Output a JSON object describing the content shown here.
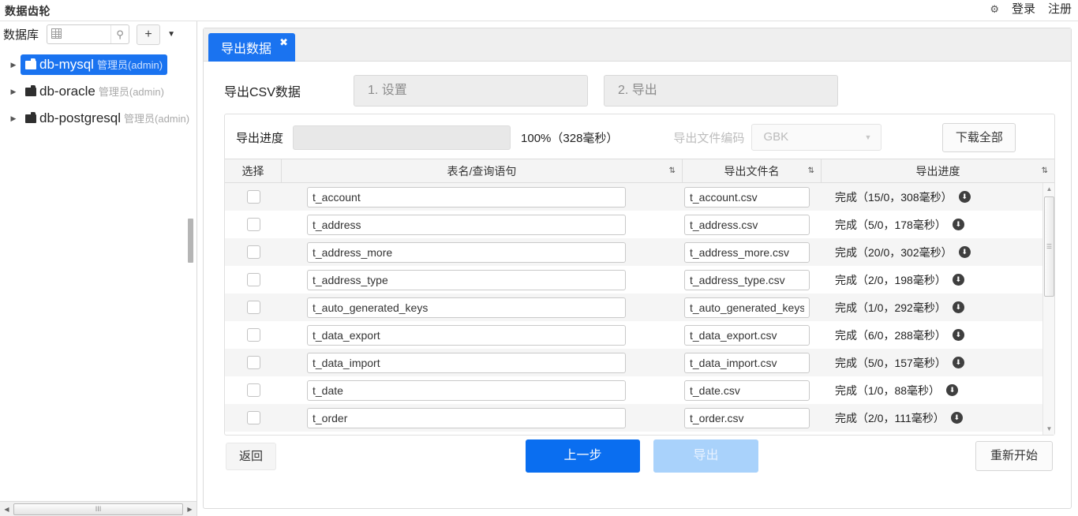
{
  "topbar": {
    "app_title": "数据齿轮",
    "gear_icon": "gear-icon",
    "login_label": "登录",
    "register_label": "注册"
  },
  "sidebar": {
    "db_label": "数据库",
    "search_value": "",
    "search_placeholder": "",
    "grid_icon": "grid-icon",
    "search_icon": "search-icon",
    "add_label": "+",
    "caret_label": "▼",
    "items": [
      {
        "name": "db-mysql",
        "role": "管理员(admin)",
        "selected": true
      },
      {
        "name": "db-oracle",
        "role": "管理员(admin)",
        "selected": false
      },
      {
        "name": "db-postgresql",
        "role": "管理员(admin)",
        "selected": false
      }
    ],
    "hscroll_grip": "III"
  },
  "tabs": [
    {
      "label": "导出数据",
      "close": "✖",
      "active": true
    }
  ],
  "wizard": {
    "title": "导出CSV数据",
    "steps": [
      {
        "label": "1. 设置"
      },
      {
        "label": "2. 导出"
      }
    ]
  },
  "progress": {
    "label": "导出进度",
    "percent_text": "100%（328毫秒）",
    "bar_percent": 0,
    "encoding_label": "导出文件编码",
    "encoding_value": "GBK",
    "encoding_caret": "▼",
    "download_all_label": "下载全部"
  },
  "table": {
    "headers": [
      {
        "label": "选择",
        "sortable": false
      },
      {
        "label": "表名/查询语句",
        "sortable": true
      },
      {
        "label": "导出文件名",
        "sortable": true
      },
      {
        "label": "导出进度",
        "sortable": true
      }
    ],
    "sort_icon": "⇅",
    "download_icon": "⬇",
    "rows": [
      {
        "checked": false,
        "table": "t_account",
        "file": "t_account.csv",
        "progress": "完成（15/0，308毫秒）"
      },
      {
        "checked": false,
        "table": "t_address",
        "file": "t_address.csv",
        "progress": "完成（5/0，178毫秒）"
      },
      {
        "checked": false,
        "table": "t_address_more",
        "file": "t_address_more.csv",
        "progress": "完成（20/0，302毫秒）"
      },
      {
        "checked": false,
        "table": "t_address_type",
        "file": "t_address_type.csv",
        "progress": "完成（2/0，198毫秒）"
      },
      {
        "checked": false,
        "table": "t_auto_generated_keys",
        "file": "t_auto_generated_keys.csv",
        "progress": "完成（1/0，292毫秒）"
      },
      {
        "checked": false,
        "table": "t_data_export",
        "file": "t_data_export.csv",
        "progress": "完成（6/0，288毫秒）"
      },
      {
        "checked": false,
        "table": "t_data_import",
        "file": "t_data_import.csv",
        "progress": "完成（5/0，157毫秒）"
      },
      {
        "checked": false,
        "table": "t_date",
        "file": "t_date.csv",
        "progress": "完成（1/0，88毫秒）"
      },
      {
        "checked": false,
        "table": "t_order",
        "file": "t_order.csv",
        "progress": "完成（2/0，111毫秒）"
      }
    ]
  },
  "footer": {
    "back_label": "返回",
    "prev_label": "上一步",
    "export_label": "导出",
    "restart_label": "重新开始"
  },
  "colors": {
    "accent": "#1a73f0",
    "accent_dark": "#0a6ef0",
    "accent_disabled": "#a9d2fb",
    "row_alt": "#f5f5f5"
  }
}
